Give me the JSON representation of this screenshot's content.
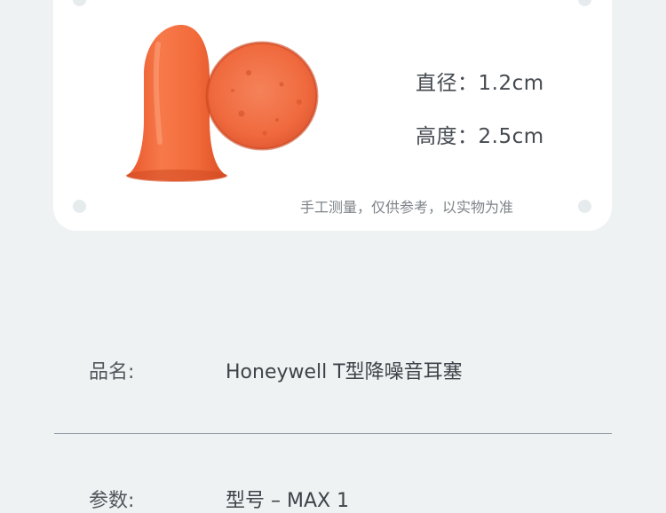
{
  "specs": {
    "diameter": "直径：1.2cm",
    "height": "高度：2.5cm",
    "note": "手工测量，仅供参考，以实物为准"
  },
  "info": {
    "name_label": "品名:",
    "name_value": "Honeywell T型降噪音耳塞",
    "params_label": "参数:",
    "params_value": "型号 – MAX 1"
  },
  "colors": {
    "background": "#eef2f3",
    "card": "#ffffff",
    "earplug": "#f26a3a"
  }
}
